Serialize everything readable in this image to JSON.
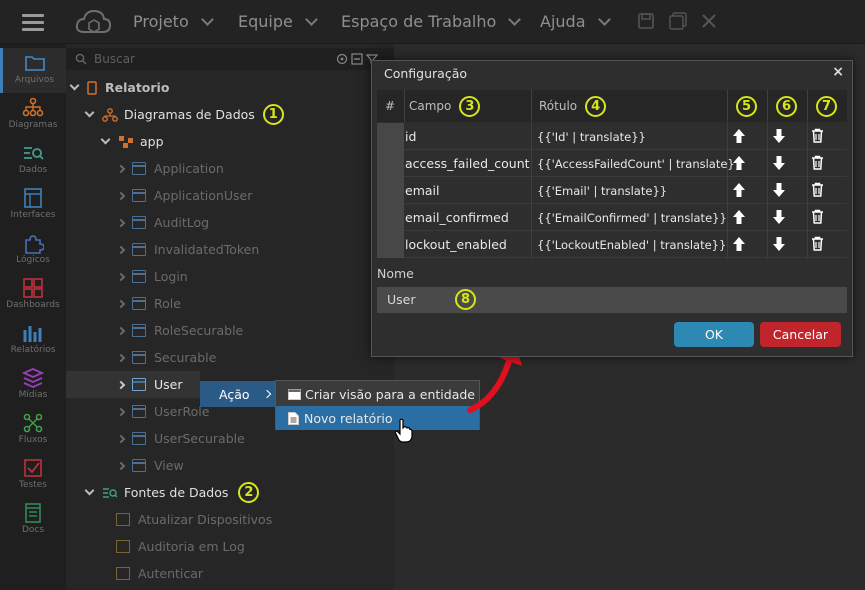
{
  "topbar": {
    "menus": [
      {
        "label": "Projeto"
      },
      {
        "label": "Equipe"
      },
      {
        "label": "Espaço de Trabalho"
      },
      {
        "label": "Ajuda"
      }
    ]
  },
  "rail": {
    "items": [
      {
        "label": "Arquivos",
        "icon": "folder-icon",
        "color": "#3f7fb8",
        "active": true
      },
      {
        "label": "Diagramas",
        "icon": "diagram-icon",
        "color": "#d0702a"
      },
      {
        "label": "Dados",
        "icon": "data-icon",
        "color": "#3fa08a"
      },
      {
        "label": "Interfaces",
        "icon": "interface-icon",
        "color": "#3f7fb8"
      },
      {
        "label": "Lógicos",
        "icon": "puzzle-icon",
        "color": "#4a6fb8"
      },
      {
        "label": "Dashboards",
        "icon": "dashboard-icon",
        "color": "#c0303a"
      },
      {
        "label": "Relatórios",
        "icon": "report-icon",
        "color": "#3f7fb8"
      },
      {
        "label": "Mídias",
        "icon": "media-icon",
        "color": "#9a3fb8"
      },
      {
        "label": "Fluxos",
        "icon": "flow-icon",
        "color": "#3fa04a"
      },
      {
        "label": "Testes",
        "icon": "test-icon",
        "color": "#c0303a"
      },
      {
        "label": "Docs",
        "icon": "docs-icon",
        "color": "#2f8a5a"
      }
    ]
  },
  "search": {
    "placeholder": "Buscar"
  },
  "tree": {
    "root": "Relatorio",
    "diagrams": "Diagramas de Dados",
    "app": "app",
    "entities": [
      "Application",
      "ApplicationUser",
      "AuditLog",
      "InvalidatedToken",
      "Login",
      "Role",
      "RoleSecurable",
      "Securable",
      "User",
      "UserRole",
      "UserSecurable",
      "View"
    ],
    "selected_entity": "User",
    "datasources": "Fontes de Dados",
    "datasource_items": [
      "Atualizar Dispositivos",
      "Auditoria em Log",
      "Autenticar"
    ]
  },
  "context_menu": {
    "action_label": "Ação",
    "items": [
      "Criar visão para a entidade",
      "Novo relatório"
    ],
    "highlighted": "Novo relatório"
  },
  "dialog": {
    "title": "Configuração",
    "columns": {
      "hash": "#",
      "field": "Campo",
      "label": "Rótulo"
    },
    "rows": [
      {
        "field": "id",
        "label": "{{'Id' | translate}}"
      },
      {
        "field": "access_failed_count",
        "label": "{{'AccessFailedCount' | translate}}"
      },
      {
        "field": "email",
        "label": "{{'Email' | translate}}"
      },
      {
        "field": "email_confirmed",
        "label": "{{'EmailConfirmed' | translate}}"
      },
      {
        "field": "lockout_enabled",
        "label": "{{'LockoutEnabled' | translate}}"
      }
    ],
    "name_label": "Nome",
    "name_value": "User",
    "ok": "OK",
    "cancel": "Cancelar"
  },
  "badges": [
    "1",
    "2",
    "3",
    "4",
    "5",
    "6",
    "7",
    "8"
  ],
  "colors": {
    "badge": "#d7e51a",
    "ok": "#2e88b4",
    "cancel": "#c0252c",
    "highlight": "#2a6ea3",
    "arrow": "#e01020"
  }
}
